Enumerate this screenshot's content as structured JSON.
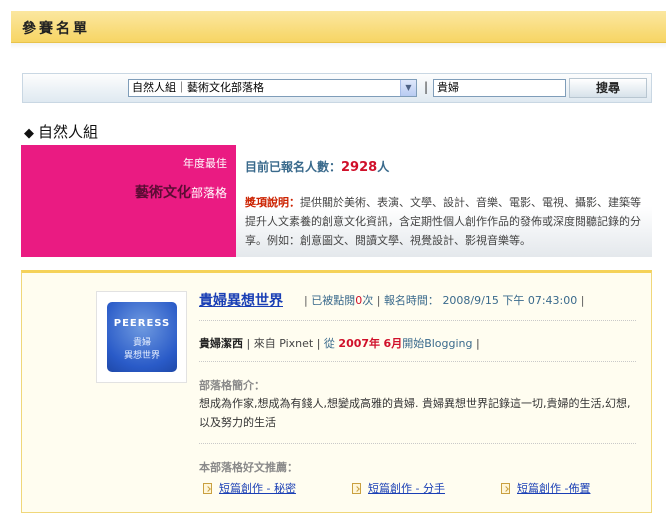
{
  "header": {
    "title": "參賽名單"
  },
  "search": {
    "category": "自然人組｜藝術文化部落格",
    "separator": "|",
    "keyword": "貴婦",
    "button": "搜尋"
  },
  "section": {
    "title": "自然人組"
  },
  "award": {
    "line1": "年度最佳",
    "line2_main": "藝術文化",
    "line2_suffix": "部落格"
  },
  "summary": {
    "count_label": "目前已報名人數：",
    "count_value": "2928",
    "count_unit": "人",
    "desc_key": "獎項說明：",
    "desc_text": "提供關於美術、表演、文學、設計、音樂、電影、電視、攝影、建築等提升人文素養的創意文化資訊，含定期性個人創作作品的發佈或深度閱聽記錄的分享。例如：創意圖文、閱讀文學、視覺設計、影視音樂等。"
  },
  "entry": {
    "logo_top": "PEERESS",
    "logo_mid": "貴婦",
    "logo_bot": "異想世界",
    "blog_title": "貴婦異想世界",
    "sep1": "|",
    "clicks_label": "已被點閱",
    "clicks_value": "0",
    "clicks_unit": "次",
    "sep2": "|",
    "reg_label": "報名時間：",
    "reg_time": "2008/9/15 下午 07:43:00",
    "sep3": "|",
    "author": "貴婦潔西",
    "from_text": "| 來自 Pixnet |",
    "since_prefix": "從",
    "since_year": "2007年",
    "since_month": "6月",
    "since_suffix": "開始Blogging",
    "sep4": "|",
    "intro_heading": "部落格簡介：",
    "intro_text": "想成為作家,想成為有錢人,想變成高雅的貴婦. 貴婦異想世界記錄這一切,貴婦的生活,幻想,以及努力的生活",
    "rec_heading": "本部落格好文推薦：",
    "recommendations": [
      "短篇創作 - 秘密",
      "短篇創作 - 分手",
      "短篇創作 -佈置"
    ]
  }
}
